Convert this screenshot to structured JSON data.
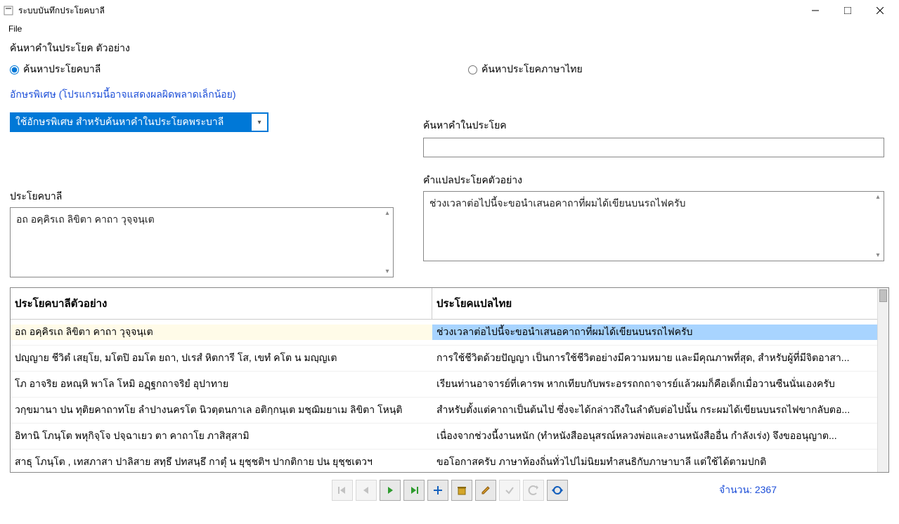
{
  "window": {
    "title": "ระบบบันทึกประโยคบาลี",
    "menu_file": "File"
  },
  "header": {
    "search_label": "ค้นหาคำในประโยค ตัวอย่าง"
  },
  "radios": {
    "pali": "ค้นหาประโยคบาลี",
    "thai": "ค้นหาประโยคภาษาไทย",
    "selected": "pali"
  },
  "special": {
    "label": "อักษรพิเศษ (โปรแกรมนี้อาจแสดงผลผิดพลาดเล็กน้อย)",
    "combo_text": "ใช้อักษรพิเศษ สำหรับค้นหาคำในประโยคพระบาลี"
  },
  "search_right": {
    "label": "ค้นหาคำในประโยค",
    "value": ""
  },
  "pali_section": {
    "label": "ประโยคบาลี",
    "text": "อถ อคฺคิรเถ ลิขิตา คาถา วุจฺจนฺเต"
  },
  "thai_section": {
    "label": "คำแปลประโยคตัวอย่าง",
    "text": "ช่วงเวลาต่อไปนี้จะขอนำเสนอคาถาที่ผมได้เขียนบนรถไฟครับ"
  },
  "grid": {
    "col1": "ประโยคบาลีตัวอย่าง",
    "col2": "ประโยคแปลไทย",
    "rows": [
      {
        "c1": "อถ อคฺคิรเถ ลิขิตา คาถา วุจฺจนฺเต",
        "c2": "ช่วงเวลาต่อไปนี้จะขอนำเสนอคาถาที่ผมได้เขียนบนรถไฟครับ"
      },
      {
        "c1": "ปญฺญาย ชีวิตํ เสยฺโย,  มโตปิ อมโต ยถา, ปเรสํ หิตการี โส, เขทํ คโต น มญฺญเต",
        "c2": "การใช้ชีวิตด้วยปัญญา เป็นการใช้ชีวิตอย่างมีความหมาย และมีคุณภาพที่สุด, สำหรับผู้ที่มีจิตอาสา..."
      },
      {
        "c1": "โภ อาจริย อหณฺหิ พาโล โหมิ อฏฺฐกถาจริยํ อุปาทาย",
        "c2": "เรียนท่านอาจารย์ที่เคารพ หากเทียบกับพระอรรถกถาจารย์แล้วผมก็คือเด็กเมื่อวานซืนนั่นเองครับ"
      },
      {
        "c1": "วกฺขมานา ปน ทุติยคาถาทโย  ลำปางนครโต นิวตฺตนกาเล อติกฺกนฺเต มชฺฌิมยาเม ลิขิตา โหนฺติ",
        "c2": "สำหรับตั้งแต่คาถาเป็นต้นไป ซึ่งจะได้กล่าวถึงในลำดับต่อไปนั้น กระผมได้เขียนบนรถไฟขากลับตอ..."
      },
      {
        "c1": "อิทานิ โภนฺโต พหุกิจฺโจ ปจฺฉาเยว ตา คาถาโย ภาสิสฺสามิ",
        "c2": "เนื่องจากช่วงนี้งานหนัก (ทำหนังสืออนุสรณ์หลวงพ่อและงานหนังสืออื่น กำลังเร่ง) จึงขออนุญาต..."
      },
      {
        "c1": "สาธุ โภนฺโต , เทสภาสา ปาลิสาย สทฺธึ  ปทสนฺธึ กาตุํ น ยุชฺชติฯ ปากติกาย ปน ยุชฺชเตวฯ",
        "c2": "ขอโอกาสครับ ภาษาท้องถิ่นทั่วไปไม่นิยมทำสนธิกับภาษาบาลี แต่ใช้ได้ตามปกติ"
      }
    ],
    "selected_index": 0
  },
  "footer": {
    "count_label": "จำนวน: 2367"
  },
  "icons": {
    "first": "first",
    "prev": "prev",
    "next": "next",
    "last": "last",
    "add": "add",
    "delete": "delete",
    "edit": "edit",
    "ok": "ok",
    "undo": "undo",
    "refresh": "refresh"
  }
}
